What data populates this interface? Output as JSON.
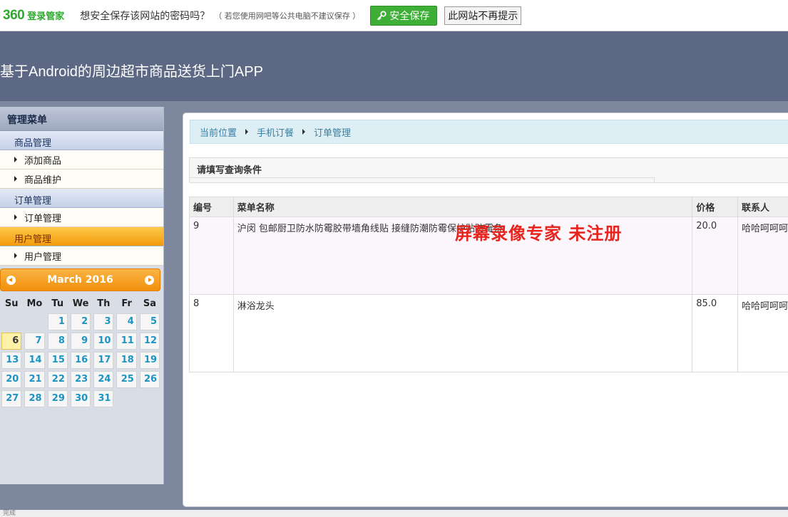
{
  "pwbar": {
    "logo": "360",
    "logo_sub": "登录管家",
    "ask": "想安全保存该网站的密码吗？",
    "note": "（ 若您使用网吧等公共电脑不建议保存 ）",
    "save_label": "安全保存",
    "never_label": "此网站不再提示",
    "save_color": "#3fae36"
  },
  "header": {
    "title": "基于Android的周边超市商品送货上门APP"
  },
  "sidebar": {
    "title": "管理菜单",
    "groups": [
      {
        "label": "商品管理",
        "items": [
          "添加商品",
          "商品维护"
        ]
      },
      {
        "label": "订单管理",
        "items": [
          "订单管理"
        ]
      },
      {
        "label": "用户管理",
        "items": [
          "用户管理"
        ],
        "active": true
      }
    ]
  },
  "calendar": {
    "month_label": "March 2016",
    "dow": [
      "Su",
      "Mo",
      "Tu",
      "We",
      "Th",
      "Fr",
      "Sa"
    ],
    "first_weekday": 2,
    "days": 31,
    "today": 6
  },
  "main": {
    "breadcrumb": [
      "当前位置",
      "手机订餐",
      "订单管理"
    ],
    "query_title": "请填写查询条件",
    "columns": [
      "编号",
      "菜单名称",
      "价格",
      "联系人"
    ],
    "rows": [
      {
        "id": "9",
        "name": "沪闵 包邮厨卫防水防霉胶带墙角线贴 接缝防潮防霉保护贴防霉条",
        "price": "20.0",
        "contact": "哈哈呵呵呵"
      },
      {
        "id": "8",
        "name": "淋浴龙头",
        "price": "85.0",
        "contact": "哈哈呵呵呵"
      }
    ]
  },
  "watermark": "屏幕录像专家  未注册",
  "status": "完成"
}
